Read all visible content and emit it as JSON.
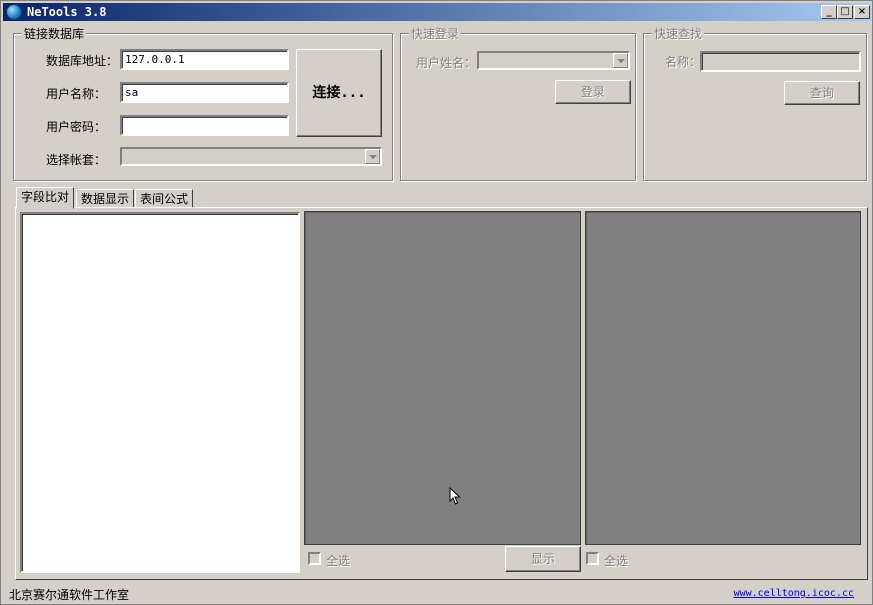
{
  "window": {
    "title": "NeTools 3.8",
    "min": "_",
    "max": "□",
    "close": "×"
  },
  "db_group": {
    "legend": "链接数据库",
    "address_label": "数据库地址：",
    "address_value": "127.0.0.1",
    "user_label": "用户名称：",
    "user_value": "sa",
    "password_label": "用户密码：",
    "password_value": "",
    "account_label": "选择帐套：",
    "connect_label": "连接..."
  },
  "quick_login": {
    "legend": "快速登录",
    "user_label": "用户姓名：",
    "login_label": "登录"
  },
  "quick_find": {
    "legend": "快速查找",
    "name_label": "名称：",
    "query_label": "查询"
  },
  "tabs": [
    {
      "label": "字段比对"
    },
    {
      "label": "数据显示"
    },
    {
      "label": "表间公式"
    }
  ],
  "panel": {
    "select_all_1": "全选",
    "show_label": "显示",
    "select_all_2": "全选"
  },
  "status": {
    "company": "北京赛尔通软件工作室",
    "link": "www.celltong.icoc.cc"
  }
}
